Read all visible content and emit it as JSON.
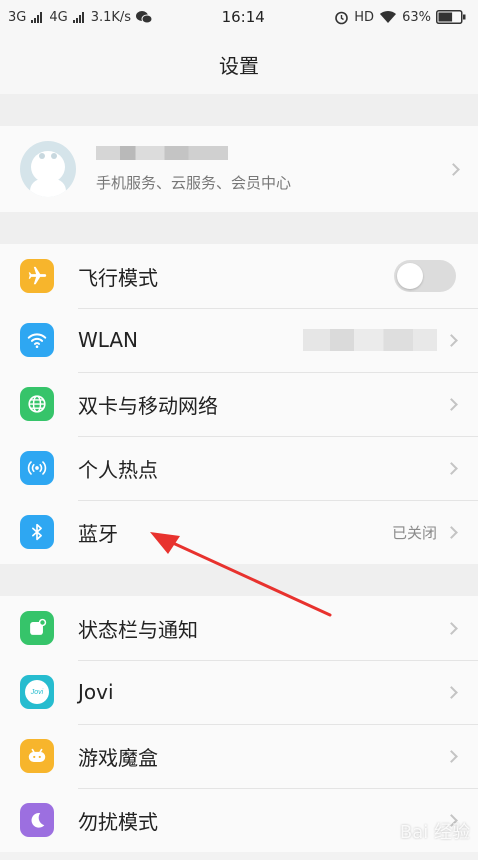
{
  "status": {
    "net1": "3G",
    "net2": "4G",
    "speed": "3.1K/s",
    "time": "16:14",
    "hd": "HD",
    "battery": "63%",
    "battery_level": 0.63
  },
  "header": {
    "title": "设置"
  },
  "account": {
    "subtitle": "手机服务、云服务、会员中心"
  },
  "group1": {
    "airplane": {
      "label": "飞行模式",
      "icon": "airplane-icon",
      "color": "#f7b52c",
      "enabled": false
    },
    "wlan": {
      "label": "WLAN",
      "icon": "wifi-icon",
      "color": "#2ea7f2"
    },
    "dual_sim": {
      "label": "双卡与移动网络",
      "icon": "globe-icon",
      "color": "#36c46a"
    },
    "hotspot": {
      "label": "个人热点",
      "icon": "hotspot-icon",
      "color": "#2ea7f2"
    },
    "bluetooth": {
      "label": "蓝牙",
      "value": "已关闭",
      "icon": "bluetooth-icon",
      "color": "#2ea7f2"
    }
  },
  "group2": {
    "statusbar": {
      "label": "状态栏与通知",
      "icon": "notification-icon",
      "color": "#36c46a"
    },
    "jovi": {
      "label": "Jovi",
      "icon_text": "Jovi",
      "icon": "jovi-icon",
      "color": "#26bccf"
    },
    "gamebox": {
      "label": "游戏魔盒",
      "icon": "gamepad-icon",
      "color": "#f7b52c"
    },
    "dnd": {
      "label": "勿扰模式",
      "icon": "moon-icon",
      "color": "#9c6fe0"
    }
  },
  "watermark": "Bai 经验"
}
